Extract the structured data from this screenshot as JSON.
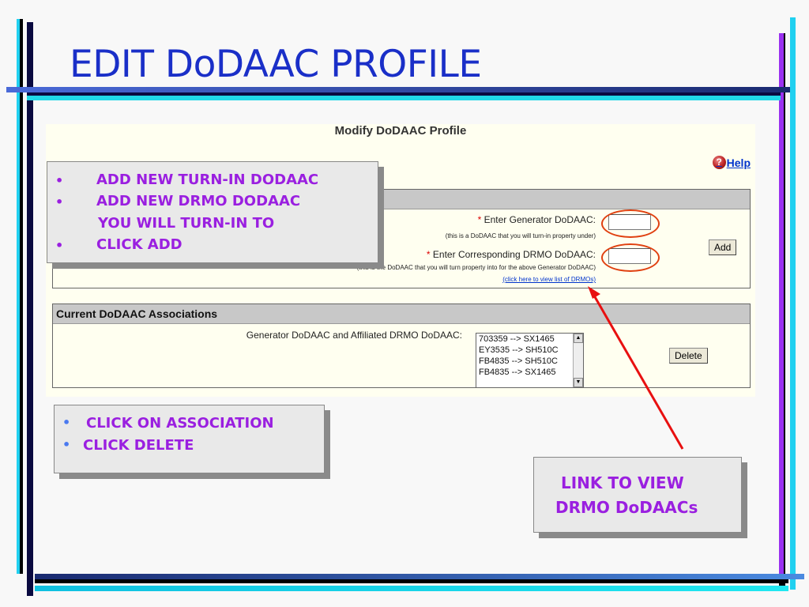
{
  "slide": {
    "title": "EDIT DoDAAC PROFILE"
  },
  "form": {
    "title": "Modify DoDAAC Profile",
    "help_label": "Help",
    "help_icon": "help-icon",
    "add_section": {
      "generator_label": "Enter Generator DoDAAC:",
      "generator_hint": "(this is a DoDAAC that you will turn-in property under)",
      "drmo_label": "Enter Corresponding DRMO DoDAAC:",
      "drmo_hint": "(this is the DoDAAC that you will turn property into for the above Generator DoDAAC)",
      "drmo_link": "(click here to view list of DRMOs)",
      "required_mark": "*",
      "generator_value": "",
      "drmo_value": "",
      "add_button": "Add"
    },
    "associations": {
      "header": "Current DoDAAC Associations",
      "list_label": "Generator DoDAAC and Affiliated DRMO DoDAAC:",
      "items": [
        "703359 --> SX1465",
        "EY3535 --> SH510C",
        "FB4835 --> SH510C",
        "FB4835 --> SX1465"
      ],
      "delete_button": "Delete"
    }
  },
  "callouts": {
    "add": {
      "bullets": [
        "ADD NEW TURN-IN DODAAC",
        "ADD NEW DRMO DODAAC",
        "CLICK ADD"
      ],
      "continuation": "YOU WILL TURN-IN TO"
    },
    "delete": {
      "bullets": [
        "CLICK ON ASSOCIATION",
        "CLICK DELETE"
      ]
    },
    "link": {
      "line1": "LINK TO VIEW",
      "line2": "DRMO DoDAACs"
    }
  },
  "colors": {
    "title": "#1a2fc8",
    "callout_text": "#9a1fe0",
    "arrow": "#e81010",
    "highlight_oval": "#e04010"
  }
}
